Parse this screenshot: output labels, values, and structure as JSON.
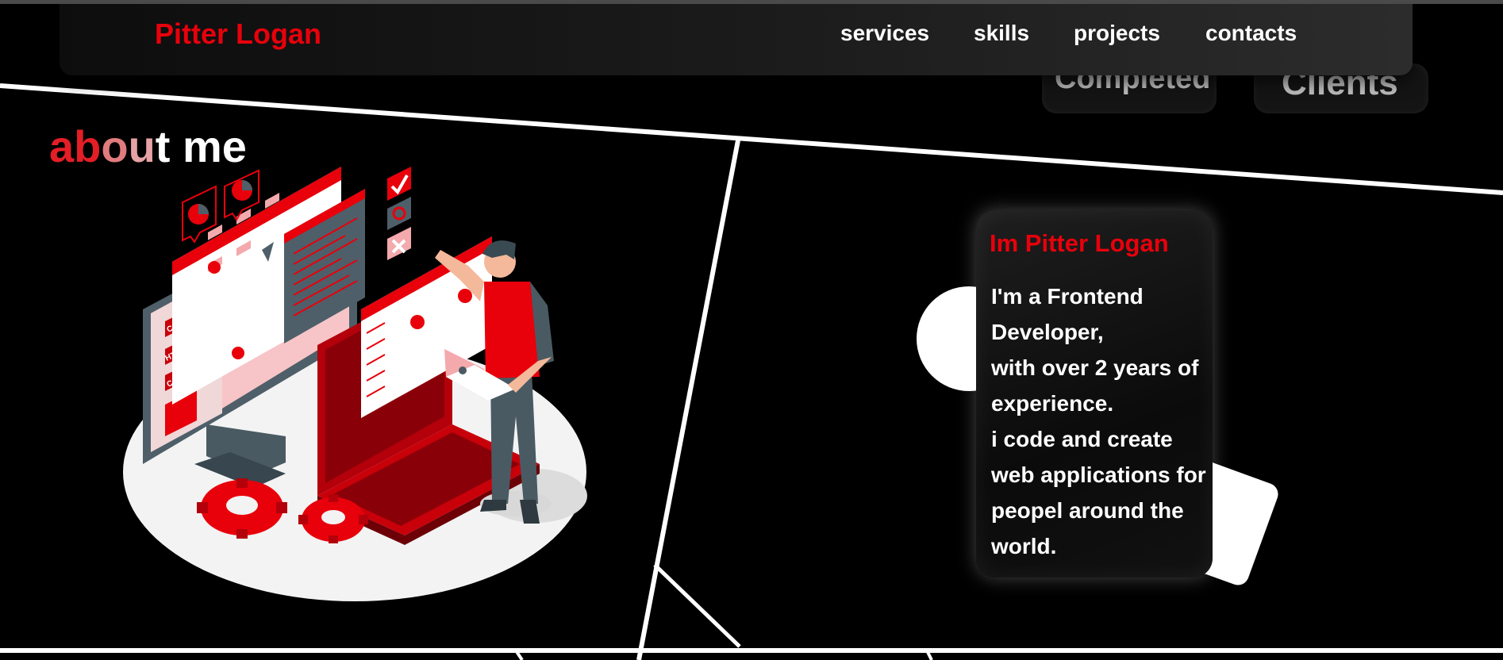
{
  "brand": "Pitter Logan",
  "nav": {
    "items": [
      {
        "label": "services"
      },
      {
        "label": "skills"
      },
      {
        "label": "projects"
      },
      {
        "label": "contacts"
      }
    ]
  },
  "stats": {
    "completed_label": "Completed",
    "clients_label": "Clients"
  },
  "about": {
    "title_parts": [
      "ab",
      "o",
      "u",
      "t me"
    ]
  },
  "bio": {
    "title": "Im Pitter Logan",
    "text": "I'm a Frontend Developer,\nwith over 2 years of experience.\ni code and create web applications for peopel around the world."
  },
  "illustration": {
    "screen_badges": [
      "CSS",
      "HTML",
      "C++"
    ]
  },
  "colors": {
    "accent": "#e8000b",
    "background": "#000000",
    "text": "#ffffff"
  },
  "icons": [
    "illustration-developer",
    "gear-icon",
    "check-icon",
    "close-icon",
    "code-icon",
    "pie-chart-icon"
  ]
}
